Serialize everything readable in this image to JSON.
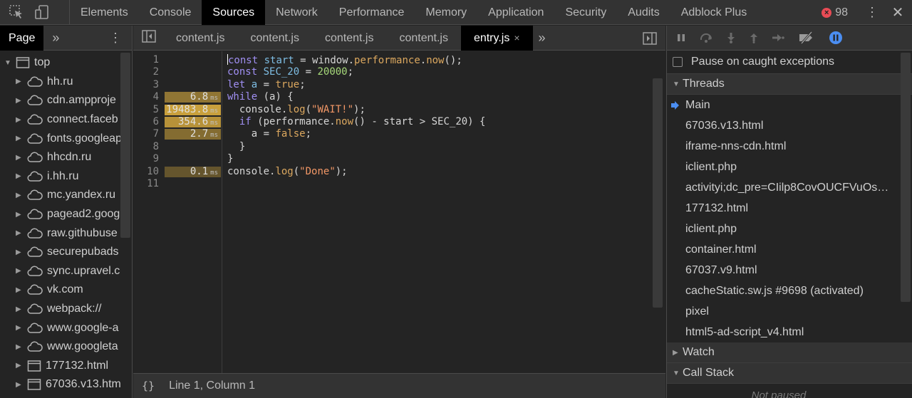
{
  "topbar": {
    "tabs": [
      "Elements",
      "Console",
      "Sources",
      "Network",
      "Performance",
      "Memory",
      "Application",
      "Security",
      "Audits",
      "Adblock Plus"
    ],
    "active_tab": "Sources",
    "error_count": "98",
    "icons": [
      "inspect-element-icon",
      "device-toolbar-icon",
      "more-vert-icon",
      "close-icon"
    ]
  },
  "navigator": {
    "page_tab": "Page",
    "more": "»",
    "items": [
      {
        "label": "top",
        "type": "frame",
        "expanded": true
      },
      {
        "label": "hh.ru",
        "type": "cloud"
      },
      {
        "label": "cdn.ampproje",
        "type": "cloud"
      },
      {
        "label": "connect.faceb",
        "type": "cloud"
      },
      {
        "label": "fonts.googleap",
        "type": "cloud"
      },
      {
        "label": "hhcdn.ru",
        "type": "cloud"
      },
      {
        "label": "i.hh.ru",
        "type": "cloud"
      },
      {
        "label": "mc.yandex.ru",
        "type": "cloud"
      },
      {
        "label": "pagead2.goog",
        "type": "cloud"
      },
      {
        "label": "raw.githubuse",
        "type": "cloud"
      },
      {
        "label": "securepubads",
        "type": "cloud"
      },
      {
        "label": "sync.upravel.c",
        "type": "cloud"
      },
      {
        "label": "vk.com",
        "type": "cloud"
      },
      {
        "label": "webpack://",
        "type": "cloud"
      },
      {
        "label": "www.google-a",
        "type": "cloud"
      },
      {
        "label": "www.googleta",
        "type": "cloud"
      },
      {
        "label": "177132.html",
        "type": "frame"
      },
      {
        "label": "67036.v13.htm",
        "type": "frame"
      }
    ]
  },
  "editor": {
    "tabs": [
      "content.js",
      "content.js",
      "content.js",
      "content.js",
      "entry.js"
    ],
    "active_tab": "entry.js",
    "tab_close": "×",
    "more": "»",
    "line_numbers": [
      "1",
      "2",
      "3",
      "4",
      "5",
      "6",
      "7",
      "8",
      "9",
      "10",
      "11"
    ],
    "perf_unit": "ms",
    "perf": [
      {
        "line": 4,
        "value": "6.8",
        "intensity": 0.55
      },
      {
        "line": 5,
        "value": "19483.8",
        "intensity": 1.0
      },
      {
        "line": 6,
        "value": "354.6",
        "intensity": 0.85
      },
      {
        "line": 7,
        "value": "2.7",
        "intensity": 0.45
      },
      {
        "line": 10,
        "value": "0.1",
        "intensity": 0.2
      }
    ],
    "code_lines": [
      [
        [
          "kw",
          "const"
        ],
        [
          "t",
          " "
        ],
        [
          "id",
          "start"
        ],
        [
          "t",
          " = window."
        ],
        [
          "fn",
          "performance"
        ],
        [
          "t",
          "."
        ],
        [
          "fn",
          "now"
        ],
        [
          "t",
          "();"
        ]
      ],
      [
        [
          "kw",
          "const"
        ],
        [
          "t",
          " "
        ],
        [
          "id",
          "SEC_20"
        ],
        [
          "t",
          " = "
        ],
        [
          "num",
          "20000"
        ],
        [
          "t",
          ";"
        ]
      ],
      [
        [
          "kw",
          "let"
        ],
        [
          "t",
          " "
        ],
        [
          "id",
          "a"
        ],
        [
          "t",
          " = "
        ],
        [
          "bool",
          "true"
        ],
        [
          "t",
          ";"
        ]
      ],
      [
        [
          "kw",
          "while"
        ],
        [
          "t",
          " (a) {"
        ]
      ],
      [
        [
          "t",
          "  console."
        ],
        [
          "fn",
          "log"
        ],
        [
          "t",
          "("
        ],
        [
          "str",
          "\"WAIT!\""
        ],
        [
          "t",
          ");"
        ]
      ],
      [
        [
          "t",
          "  "
        ],
        [
          "kw",
          "if"
        ],
        [
          "t",
          " (performance."
        ],
        [
          "fn",
          "now"
        ],
        [
          "t",
          "() - start > SEC_20) {"
        ]
      ],
      [
        [
          "t",
          "    a = "
        ],
        [
          "bool",
          "false"
        ],
        [
          "t",
          ";"
        ]
      ],
      [
        [
          "t",
          "  }"
        ]
      ],
      [
        [
          "t",
          "}"
        ]
      ],
      [
        [
          "t",
          "console."
        ],
        [
          "fn",
          "log"
        ],
        [
          "t",
          "("
        ],
        [
          "str",
          "\"Done\""
        ],
        [
          "t",
          ");"
        ]
      ],
      [
        [
          "t",
          ""
        ]
      ]
    ],
    "status": {
      "braces": "{}",
      "position": "Line 1, Column 1"
    }
  },
  "debugger": {
    "pause_on_caught": "Pause on caught exceptions",
    "threads_title": "Threads",
    "threads": [
      "Main",
      "67036.v13.html",
      "iframe-nns-cdn.html",
      "iclient.php",
      "activityi;dc_pre=CIilp8CovOUCFVuOs…",
      "177132.html",
      "iclient.php",
      "container.html",
      "67037.v9.html",
      "cacheStatic.sw.js #9698 (activated)",
      "pixel",
      "html5-ad-script_v4.html"
    ],
    "watch_title": "Watch",
    "callstack_title": "Call Stack",
    "not_paused": "Not paused"
  },
  "colors": {
    "accent": "#4b8ef2",
    "perf_bar": "#c9a03c",
    "error": "#e84b55"
  }
}
